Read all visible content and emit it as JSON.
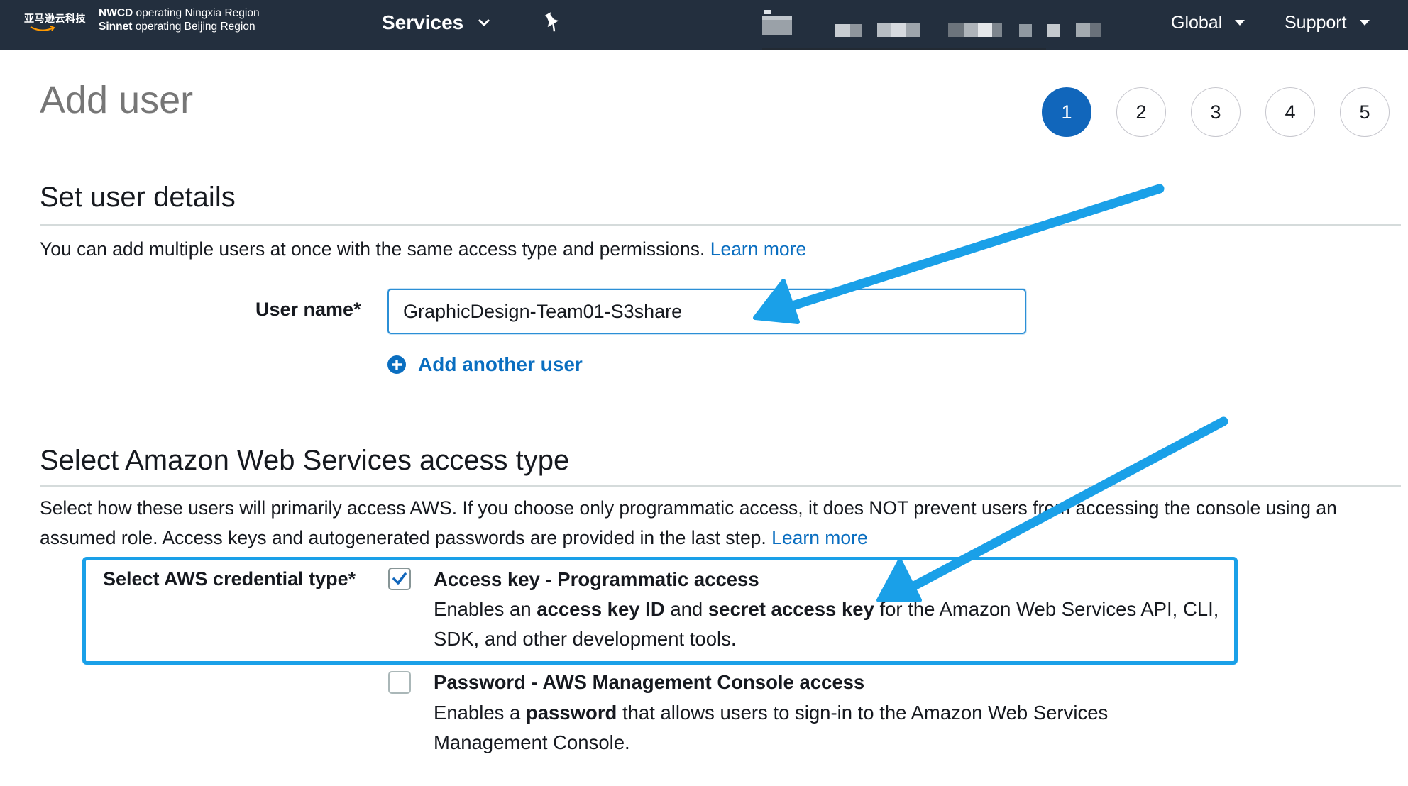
{
  "header": {
    "logo_text": "亚马逊云科技",
    "region_line1_bold": "NWCD",
    "region_line1_rest": "operating Ningxia Region",
    "region_line2_bold": "Sinnet",
    "region_line2_rest": "operating Beijing Region",
    "services_label": "Services",
    "global_label": "Global",
    "support_label": "Support"
  },
  "page": {
    "title": "Add user",
    "steps": [
      "1",
      "2",
      "3",
      "4",
      "5"
    ],
    "active_step": "1"
  },
  "user_details": {
    "title": "Set user details",
    "description": "You can add multiple users at once with the same access type and permissions.",
    "learn_more": "Learn more",
    "user_name_label": "User name*",
    "user_name_value": "GraphicDesign-Team01-S3share",
    "add_another_user": "Add another user"
  },
  "access_type": {
    "title": "Select Amazon Web Services access type",
    "description": "Select how these users will primarily access AWS. If you choose only programmatic access, it does NOT prevent users from accessing the console using an assumed role. Access keys and autogenerated passwords are provided in the last step.",
    "learn_more": "Learn more",
    "credential_label": "Select AWS credential type*",
    "options": [
      {
        "title": "Access key - Programmatic access",
        "desc_pre": "Enables an ",
        "desc_b1": "access key ID",
        "desc_mid": " and ",
        "desc_b2": "secret access key",
        "desc_post": " for the Amazon Web Services API, CLI, SDK, and other development tools.",
        "checked": true
      },
      {
        "title": "Password - AWS Management Console access",
        "desc_pre": "Enables a ",
        "desc_b1": "password",
        "desc_post": " that allows users to sign-in to the Amazon Web Services Management Console.",
        "checked": false
      }
    ]
  },
  "colors": {
    "nav_background": "#232f3e",
    "primary_blue": "#1166bb",
    "link_blue": "#0a6ec0",
    "annotation_blue": "#1aa0e8"
  }
}
